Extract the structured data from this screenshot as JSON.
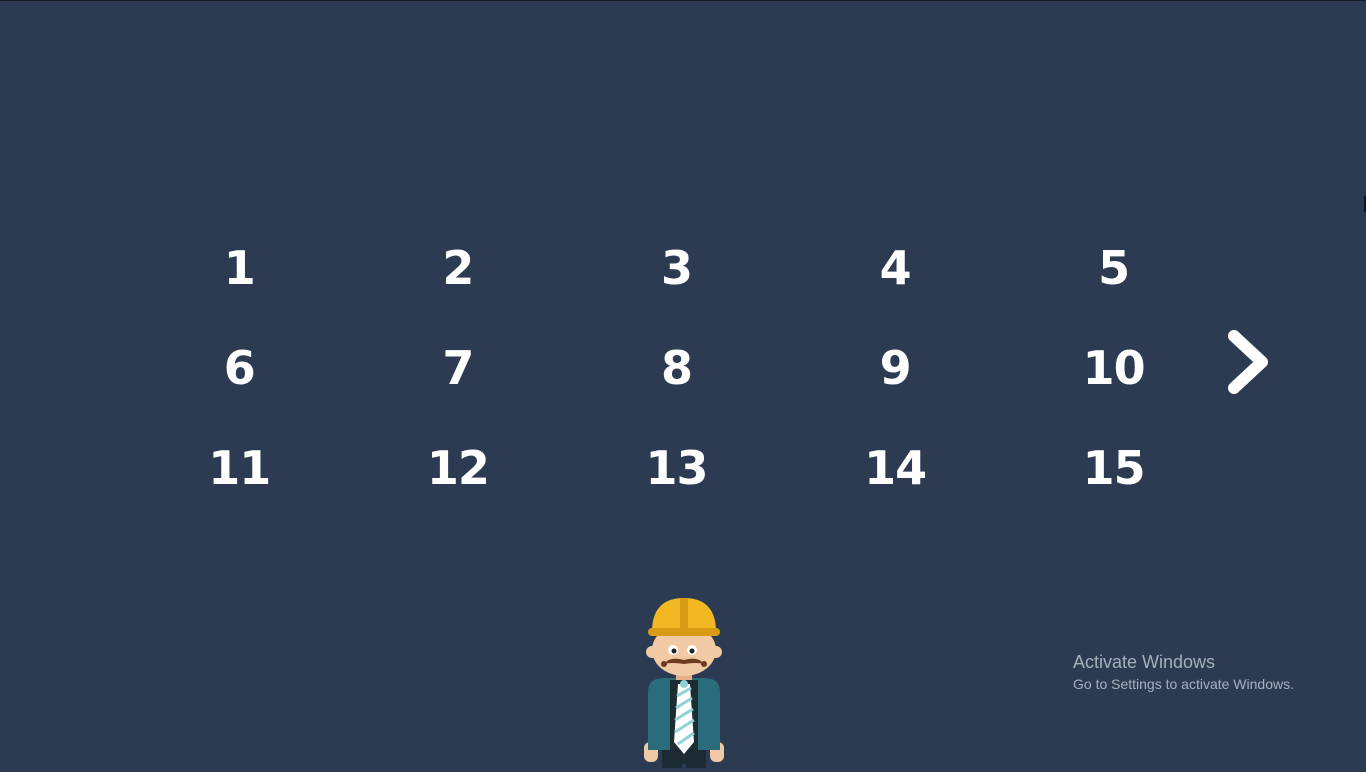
{
  "levels": [
    "1",
    "2",
    "3",
    "4",
    "5",
    "6",
    "7",
    "8",
    "9",
    "10",
    "11",
    "12",
    "13",
    "14",
    "15"
  ],
  "navigation": {
    "next_icon": "chevron-right-icon"
  },
  "character": {
    "icon": "construction-worker-mascot"
  },
  "watermark": {
    "title": "Activate Windows",
    "subtitle": "Go to Settings to activate Windows."
  },
  "colors": {
    "background": "#2c3b52",
    "text": "#ffffff",
    "helmet": "#f2b824",
    "jacket": "#2a6b7c",
    "watermark": "#a7afbb"
  }
}
